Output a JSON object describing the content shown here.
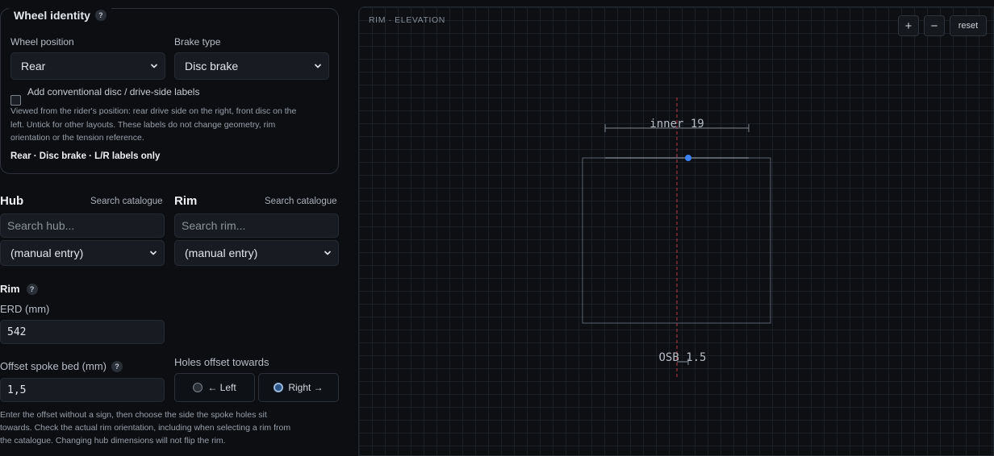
{
  "wheel_identity": {
    "title": "Wheel identity",
    "help": "?",
    "position_label": "Wheel position",
    "position_value": "Rear",
    "brake_label": "Brake type",
    "brake_value": "Disc brake",
    "checkbox_label": "Add conventional disc / drive-side labels",
    "description_lines": [
      "Viewed from the rider's position: rear drive side on the right, front disc on the",
      "left. Untick for other layouts. These labels do not change geometry, rim",
      "orientation or the tension reference."
    ],
    "summary": "Rear · Disc brake · L/R labels only"
  },
  "hub": {
    "title": "Hub",
    "catalogue_link": "Search catalogue",
    "search_placeholder": "Search hub...",
    "select_value": "(manual entry)"
  },
  "rim_select": {
    "title": "Rim",
    "catalogue_link": "Search catalogue",
    "search_placeholder": "Search rim...",
    "select_value": "(manual entry)"
  },
  "rim": {
    "title": "Rim",
    "help": "?",
    "erd_label": "ERD (mm)",
    "erd_value": "542",
    "osb_label": "Offset spoke bed (mm)",
    "osb_value": "1,5",
    "holes_label": "Holes offset towards",
    "left_option": "← Left",
    "right_option": "Right →",
    "selected": "right",
    "note_lines": [
      "Enter the offset without a sign, then choose the side the spoke holes sit",
      "towards. Check the actual rim orientation, including when selecting a rim from",
      "the catalogue. Changing hub dimensions will not flip the rim."
    ]
  },
  "diagram": {
    "title": "RIM · ELEVATION",
    "zoom_in": "+",
    "zoom_out": "−",
    "reset": "reset",
    "inner_label": "inner 19",
    "osb_label": "OSB 1.5",
    "colors": {
      "center_line": "#c0394b",
      "hole": "#3b82f6",
      "outline": "#6b727c"
    }
  }
}
